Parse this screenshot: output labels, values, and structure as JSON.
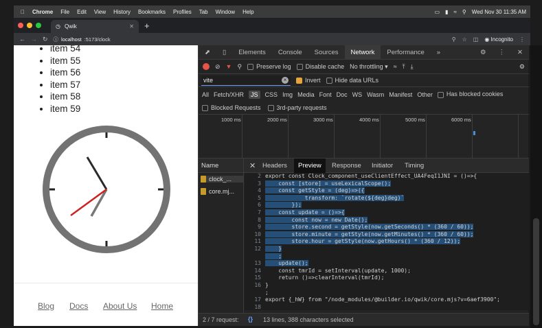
{
  "menubar": {
    "app": "Chrome",
    "items": [
      "File",
      "Edit",
      "View",
      "History",
      "Bookmarks",
      "Profiles",
      "Tab",
      "Window",
      "Help"
    ],
    "clock": "Wed Nov 30  11:35 AM"
  },
  "browser": {
    "tab_title": "Qwik",
    "url_host": "localhost",
    "url_rest": ":5173/clock",
    "incognito": "Incognito"
  },
  "page": {
    "items": [
      "item 54",
      "item 55",
      "item 56",
      "item 57",
      "item 58",
      "item 59"
    ],
    "footer_links": [
      "Blog",
      "Docs",
      "About Us",
      "Home"
    ]
  },
  "devtools": {
    "tabs": [
      "Elements",
      "Console",
      "Sources",
      "Network",
      "Performance"
    ],
    "active_tab": "Network",
    "preserve_log": "Preserve log",
    "disable_cache": "Disable cache",
    "throttling": "No throttling",
    "filter_value": "vite",
    "invert": "Invert",
    "hide_data_urls": "Hide data URLs",
    "types": [
      "All",
      "Fetch/XHR",
      "JS",
      "CSS",
      "Img",
      "Media",
      "Font",
      "Doc",
      "WS",
      "Wasm",
      "Manifest",
      "Other"
    ],
    "active_type": "JS",
    "has_blocked_cookies": "Has blocked cookies",
    "blocked_requests": "Blocked Requests",
    "third_party": "3rd-party requests",
    "timeline_ticks": [
      "1000 ms",
      "2000 ms",
      "3000 ms",
      "4000 ms",
      "5000 ms",
      "6000 ms"
    ],
    "name_header": "Name",
    "requests": [
      "clock_...",
      "core.mj..."
    ],
    "detail_tabs": [
      "Headers",
      "Preview",
      "Response",
      "Initiator",
      "Timing"
    ],
    "active_detail_tab": "Preview",
    "request_count": "2 / 7 request:",
    "selection_info": "13 lines, 388 characters selected",
    "format_icon": "{}"
  },
  "code": [
    {
      "n": "2",
      "t": "export const Clock_component_useClientEffect_UA4FeqI1JNI = ()=>{"
    },
    {
      "n": "3",
      "t": "    const [store] = useLexicalScope();"
    },
    {
      "n": "4",
      "t": "    const getStyle = (deg)=>({"
    },
    {
      "n": "5",
      "t": "            transform: `rotate(${deg}deg)`"
    },
    {
      "n": "6",
      "t": "        });"
    },
    {
      "n": "7",
      "t": "    const update = ()=>{"
    },
    {
      "n": "8",
      "t": "        const now = new Date();"
    },
    {
      "n": "9",
      "t": "        store.second = getStyle(now.getSeconds() * (360 / 60));"
    },
    {
      "n": "10",
      "t": "        store.minute = getStyle(now.getMinutes() * (360 / 60));"
    },
    {
      "n": "11",
      "t": "        store.hour = getStyle(now.getHours() * (360 / 12));"
    },
    {
      "n": "12",
      "t": "    }"
    },
    {
      "n": "",
      "t": "    ;"
    },
    {
      "n": "13",
      "t": "    update();"
    },
    {
      "n": "14",
      "t": "    const tmrId = setInterval(update, 1000);"
    },
    {
      "n": "15",
      "t": "    return ()=>clearInterval(tmrId);"
    },
    {
      "n": "16",
      "t": "}"
    },
    {
      "n": "",
      "t": ";"
    },
    {
      "n": "17",
      "t": "export {_hW} from \"/node_modules/@builder.io/qwik/core.mjs?v=6aef3900\";"
    },
    {
      "n": "18",
      "t": ""
    }
  ],
  "colors": {
    "accent": "#e7a33e",
    "selection": "#264f78",
    "second_hand": "#cc2222"
  }
}
